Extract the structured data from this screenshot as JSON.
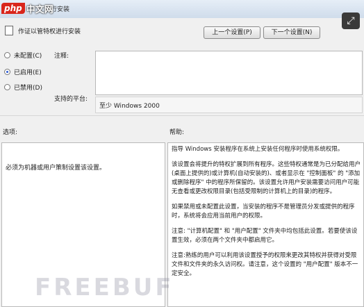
{
  "logo": {
    "brand": "php",
    "cn": "中文网"
  },
  "window": {
    "title": "进行安装"
  },
  "header": {
    "title": "作证以管特权进行安装"
  },
  "nav": {
    "prev": "上一个设置(P)",
    "next": "下一个设置(N)"
  },
  "state": {
    "options": [
      {
        "label": "未配置(C)",
        "selected": false
      },
      {
        "label": "已启用(E)",
        "selected": true
      },
      {
        "label": "已禁用(D)",
        "selected": false
      }
    ]
  },
  "comment": {
    "label": "注释:",
    "value": ""
  },
  "platform": {
    "label": "支持的平台:",
    "value": "至少 Windows 2000"
  },
  "options_section": {
    "label": "选项:",
    "text": "必须为机器或用户策制设置该设置。"
  },
  "help_section": {
    "label": "帮助:",
    "paragraphs": [
      "指导 Windows 安装程序在系统上安装任何程序时使用系统权限。",
      "该设置会将提升的特权扩展到所有程序。这些特权通常是为已分配给用户(桌面上提供的)或计算机(自动安装的)、或者显示在 \"控制面板\" 的 \"添加或删除程序\" 中的程序所保留的。该设置允许用户安装需要访问用户可能无查看或更改权限目录(包括受限制的计算机上的目录)的程序。",
      "如果禁用或未配置此设置，当安装的程序不是管理员分发或提供的程序时，系统将会应用当前用户的权限。",
      "注意: \"计算机配置\" 和 \"用户配置\" 文件夹中均包括此设置。若要使该设置生效，必须在两个文件夹中都启用它。",
      "注意:熟练的用户可以利用该设置授予的权限来更改其特权并获得对受限文件和文件夹的永久访问权。请注意，这个设置的 \"用户配置\" 版本不一定安全。"
    ]
  },
  "watermark": {
    "text": "FREEBUF"
  },
  "expand_icon": "expand-icon"
}
